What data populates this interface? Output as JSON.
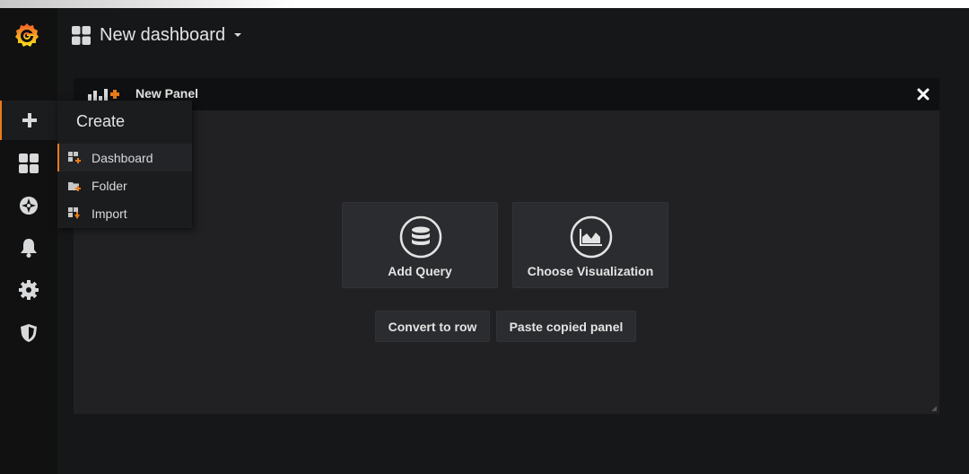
{
  "dashboard": {
    "title": "New dashboard"
  },
  "sidemenu": {
    "items": [
      {
        "icon": "plus-icon"
      },
      {
        "icon": "dashboards-icon"
      },
      {
        "icon": "compass-icon"
      },
      {
        "icon": "bell-icon"
      },
      {
        "icon": "gear-icon"
      },
      {
        "icon": "shield-icon"
      }
    ]
  },
  "create_menu": {
    "title": "Create",
    "items": [
      {
        "label": "Dashboard",
        "icon": "dashboard-add-icon"
      },
      {
        "label": "Folder",
        "icon": "folder-add-icon"
      },
      {
        "label": "Import",
        "icon": "import-icon"
      }
    ]
  },
  "panel": {
    "title": "New Panel",
    "actions": {
      "add_query": "Add Query",
      "choose_visualization": "Choose Visualization",
      "convert_to_row": "Convert to row",
      "paste_copied_panel": "Paste copied panel"
    }
  },
  "colors": {
    "accent": "#eb7b18",
    "background": "#161719",
    "panel": "#212124"
  }
}
